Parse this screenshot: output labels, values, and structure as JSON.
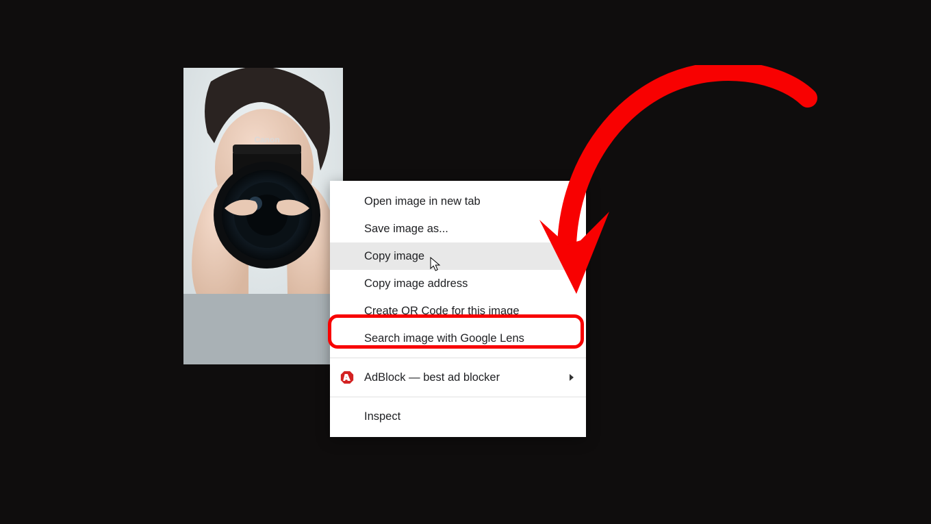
{
  "context_menu": {
    "items": [
      {
        "label": "Open image in new tab"
      },
      {
        "label": "Save image as..."
      },
      {
        "label": "Copy image"
      },
      {
        "label": "Copy image address"
      },
      {
        "label": "Create QR Code for this image"
      },
      {
        "label": "Search image with Google Lens"
      },
      {
        "label": "AdBlock — best ad blocker"
      },
      {
        "label": "Inspect"
      }
    ]
  },
  "annotation": {
    "highlight_color": "#f80101"
  }
}
